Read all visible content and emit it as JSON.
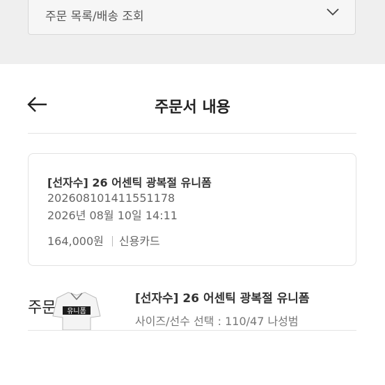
{
  "dropdown": {
    "label": "주문 목록/배송 조회"
  },
  "header": {
    "title": "주문서 내용"
  },
  "order_card": {
    "title": "[선자수] 26 어센틱 광복절 유니폼",
    "order_number": "20260810141155117​8",
    "order_datetime": "2026년 08월 10일 14:11",
    "price": "164,000원",
    "payment_method": "신용카드"
  },
  "section": {
    "title": "주문 상품"
  },
  "product": {
    "title": "[선자수] 26 어센틱 광복절 유니폼",
    "option": "사이즈/선수 선택 : 110/47 나성범",
    "thumbnail_text": "유니폼"
  },
  "icons": {
    "dropdown": "chevron-down-icon",
    "back": "arrow-left-icon"
  }
}
